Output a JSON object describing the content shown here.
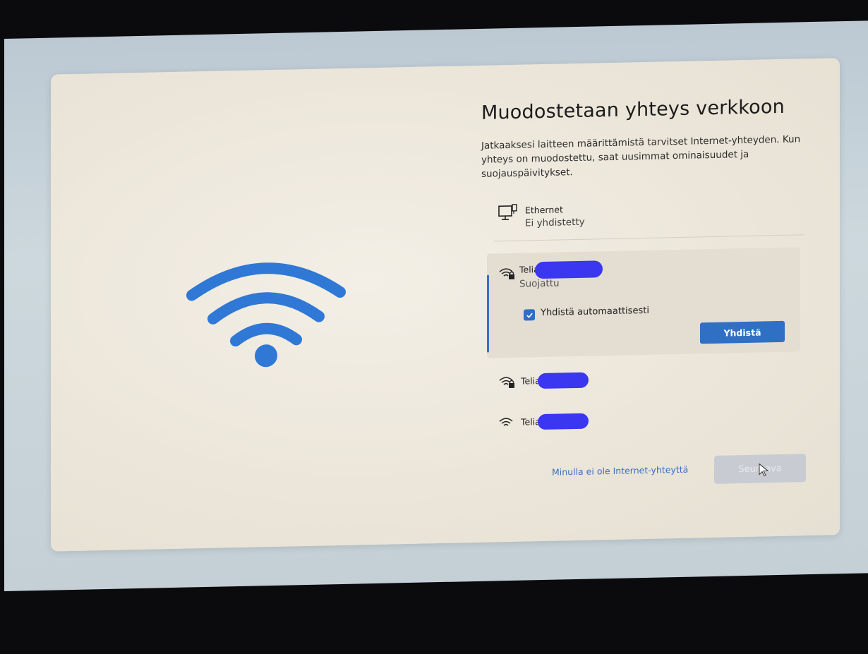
{
  "page": {
    "title": "Muodostetaan yhteys verkkoon",
    "description": "Jatkaaksesi laitteen määrittämistä tarvitset Internet-yhteyden. Kun yhteys on muodostettu, saat uusimmat ominaisuudet ja suojauspäivitykset."
  },
  "ethernet": {
    "name": "Ethernet",
    "status": "Ei yhdistetty",
    "icon": "ethernet-icon"
  },
  "networks": [
    {
      "name": "Telia",
      "status": "Suojattu",
      "secured": true,
      "selected": true,
      "auto_connect_label": "Yhdistä automaattisesti",
      "auto_connect_checked": true,
      "connect_label": "Yhdistä"
    },
    {
      "name": "Telia",
      "secured": true,
      "selected": false
    },
    {
      "name": "Telia",
      "secured": false,
      "selected": false
    }
  ],
  "footer": {
    "no_internet_link": "Minulla ei ole Internet-yhteyttä",
    "next_label": "Seuraava"
  },
  "colors": {
    "accent": "#2f6fc4",
    "redaction": "#3b36f0",
    "panel": "#ece6da"
  }
}
